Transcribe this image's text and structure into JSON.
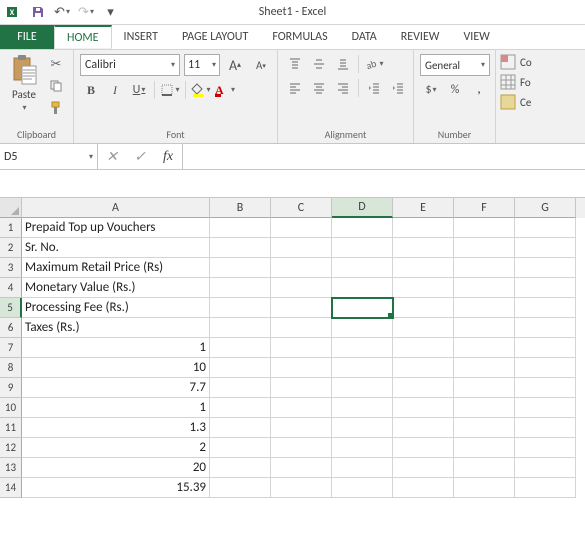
{
  "titlebar": {
    "title": "Sheet1 - Excel"
  },
  "tabs": {
    "file": "FILE",
    "items": [
      "HOME",
      "INSERT",
      "PAGE LAYOUT",
      "FORMULAS",
      "DATA",
      "REVIEW",
      "VIEW"
    ],
    "active": "HOME"
  },
  "ribbon": {
    "clipboard": {
      "paste_label": "Paste",
      "group_label": "Clipboard"
    },
    "font": {
      "name": "Calibri",
      "size": "11",
      "group_label": "Font",
      "bold": "B",
      "italic": "I",
      "underline": "U",
      "grow": "A",
      "shrink": "A"
    },
    "alignment": {
      "group_label": "Alignment"
    },
    "number": {
      "format": "General",
      "group_label": "Number"
    },
    "cells": {
      "cond": "Co",
      "form": "Fo",
      "cell": "Ce"
    }
  },
  "namebox": "D5",
  "formula": "",
  "fx": "fx",
  "grid": {
    "cols": [
      "A",
      "B",
      "C",
      "D",
      "E",
      "F",
      "G"
    ],
    "rows": [
      {
        "n": 1,
        "a": "Prepaid Top up Vouchers"
      },
      {
        "n": 2,
        "a": "Sr. No."
      },
      {
        "n": 3,
        "a": "Maximum Retail Price (Rs)"
      },
      {
        "n": 4,
        "a": "Monetary Value (Rs.)"
      },
      {
        "n": 5,
        "a": "Processing Fee (Rs.)"
      },
      {
        "n": 6,
        "a": "Taxes (Rs.)"
      },
      {
        "n": 7,
        "a": "1",
        "num": true
      },
      {
        "n": 8,
        "a": "10",
        "num": true
      },
      {
        "n": 9,
        "a": "7.7",
        "num": true
      },
      {
        "n": 10,
        "a": "1",
        "num": true
      },
      {
        "n": 11,
        "a": "1.3",
        "num": true
      },
      {
        "n": 12,
        "a": "2",
        "num": true
      },
      {
        "n": 13,
        "a": "20",
        "num": true
      },
      {
        "n": 14,
        "a": "15.39",
        "num": true
      }
    ],
    "active": {
      "col": "D",
      "row": 5
    }
  }
}
